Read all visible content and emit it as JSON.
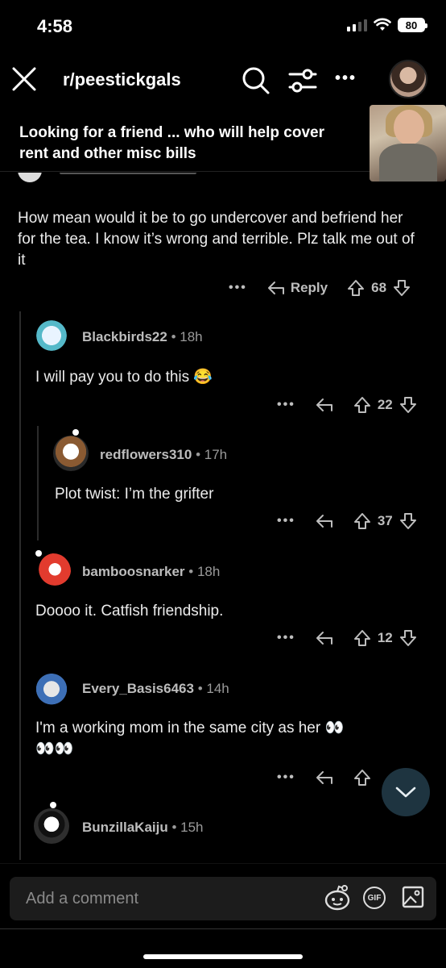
{
  "status": {
    "time": "4:58",
    "battery": "80"
  },
  "header": {
    "subreddit": "r/peestickgals"
  },
  "post": {
    "title": "Looking for a friend ... who will help cover rent and other misc bills"
  },
  "comments": [
    {
      "text": "How mean would it be to go undercover and befriend her for the tea. I know it’s wrong and terrible. Plz talk me out of it",
      "reply_label": "Reply",
      "votes": "68"
    },
    {
      "user": "Blackbirds22",
      "age": "18h",
      "text": "I will pay you to do this 😂",
      "votes": "22"
    },
    {
      "user": "redflowers310",
      "age": "17h",
      "text": "Plot twist: I’m the grifter",
      "votes": "37"
    },
    {
      "user": "bamboosnarker",
      "age": "18h",
      "text": "Doooo it. Catfish friendship.",
      "votes": "12"
    },
    {
      "user": "Every_Basis6463",
      "age": "14h",
      "text": "I'm a working mom in the same city as her 👀",
      "text2": "👀👀",
      "votes": ""
    },
    {
      "user": "BunzillaKaiju",
      "age": "15h"
    }
  ],
  "composer": {
    "placeholder": "Add a comment",
    "gif_label": "GIF"
  },
  "colors": {
    "background": "#000000",
    "fab": "#1e3440",
    "input": "#1c1c1c"
  }
}
